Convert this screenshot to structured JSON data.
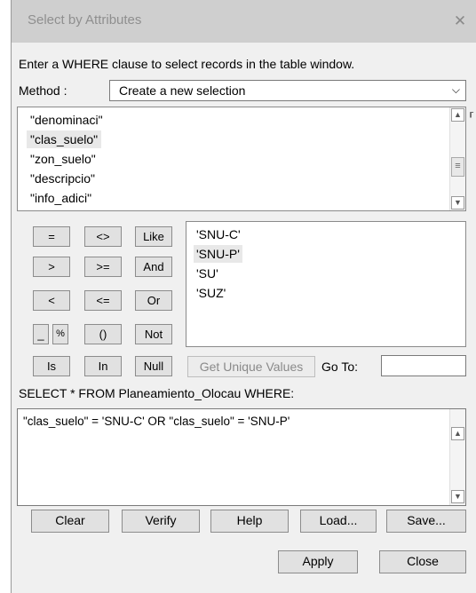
{
  "window": {
    "title": "Select by Attributes",
    "close_glyph": "✕"
  },
  "instruction": "Enter a WHERE clause to select records in the table window.",
  "method": {
    "label": "Method :",
    "value": "Create a new selection"
  },
  "fields": [
    "\"denominaci\"",
    "\"clas_suelo\"",
    "\"zon_suelo\"",
    "\"descripcio\"",
    "\"info_adici\""
  ],
  "fields_selected_index": 1,
  "operators": {
    "eq": "=",
    "ne": "<>",
    "like": "Like",
    "gt": ">",
    "ge": ">=",
    "and": "And",
    "lt": "<",
    "le": "<=",
    "or": "Or",
    "underscore": "_",
    "percent": "%",
    "parens": "()",
    "not": "Not",
    "is": "Is",
    "in": "In",
    "null": "Null"
  },
  "unique_values": [
    "'SNU-C'",
    "'SNU-P'",
    "'SU'",
    "'SUZ'"
  ],
  "unique_selected_index": 1,
  "get_unique_values_label": "Get Unique Values",
  "goto_label": "Go To:",
  "goto_value": "",
  "select_statement": "SELECT * FROM Planeamiento_Olocau WHERE:",
  "where_clause": "\"clas_suelo\" = 'SNU-C' OR \"clas_suelo\" = 'SNU-P'",
  "bottom_buttons": {
    "clear": "Clear",
    "verify": "Verify",
    "help": "Help",
    "load": "Load...",
    "save": "Save..."
  },
  "dialog_buttons": {
    "apply": "Apply",
    "close": "Close"
  },
  "icons": {
    "close": "close-icon",
    "dropdown": "chevron-down-icon",
    "scroll_up": "chevron-up-icon",
    "scroll_down": "chevron-down-icon",
    "scroll_thumb": "grip-icon"
  }
}
